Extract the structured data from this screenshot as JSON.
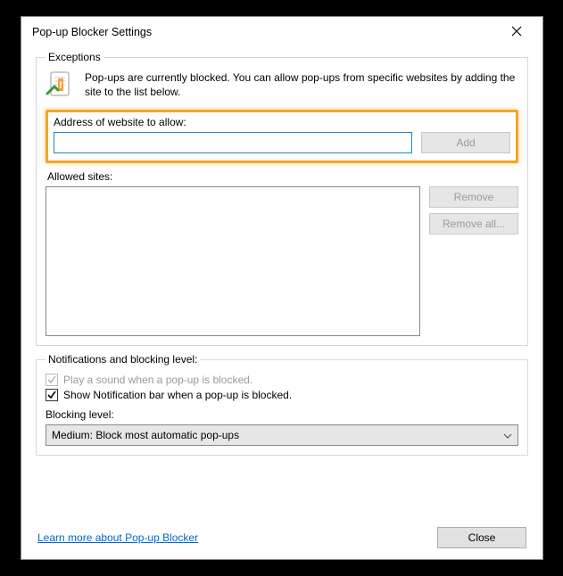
{
  "window": {
    "title": "Pop-up Blocker Settings"
  },
  "exceptions": {
    "legend": "Exceptions",
    "description": "Pop-ups are currently blocked.  You can allow pop-ups from specific websites by adding the site to the list below.",
    "address_label": "Address of website to allow:",
    "address_value": "",
    "add_label": "Add",
    "allowed_label": "Allowed sites:",
    "remove_label": "Remove",
    "remove_all_label": "Remove all..."
  },
  "notifications": {
    "legend": "Notifications and blocking level:",
    "play_sound_label": "Play a sound when a pop-up is blocked.",
    "play_sound_checked": true,
    "play_sound_enabled": false,
    "show_bar_label": "Show Notification bar when a pop-up is blocked.",
    "show_bar_checked": true,
    "blocking_level_label": "Blocking level:",
    "blocking_level_value": "Medium: Block most automatic pop-ups"
  },
  "footer": {
    "learn_more": "Learn more about Pop-up Blocker",
    "close": "Close"
  }
}
